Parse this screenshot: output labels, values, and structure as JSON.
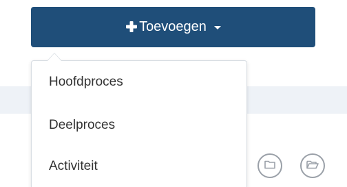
{
  "toolbar": {
    "add_label": "Toevoegen",
    "add_icon": "plus-icon",
    "dropdown_icon": "caret-down-icon"
  },
  "dropdown": {
    "items": [
      {
        "label": "Hoofdproces"
      },
      {
        "label": "Deelproces"
      },
      {
        "label": "Activiteit"
      }
    ]
  },
  "actions": {
    "folder_icon": "folder-icon",
    "folder_open_icon": "folder-open-icon"
  },
  "colors": {
    "primary": "#1f4e79",
    "band": "#eef2f7",
    "text": "#333333",
    "icon_border": "#9aa0a8"
  }
}
